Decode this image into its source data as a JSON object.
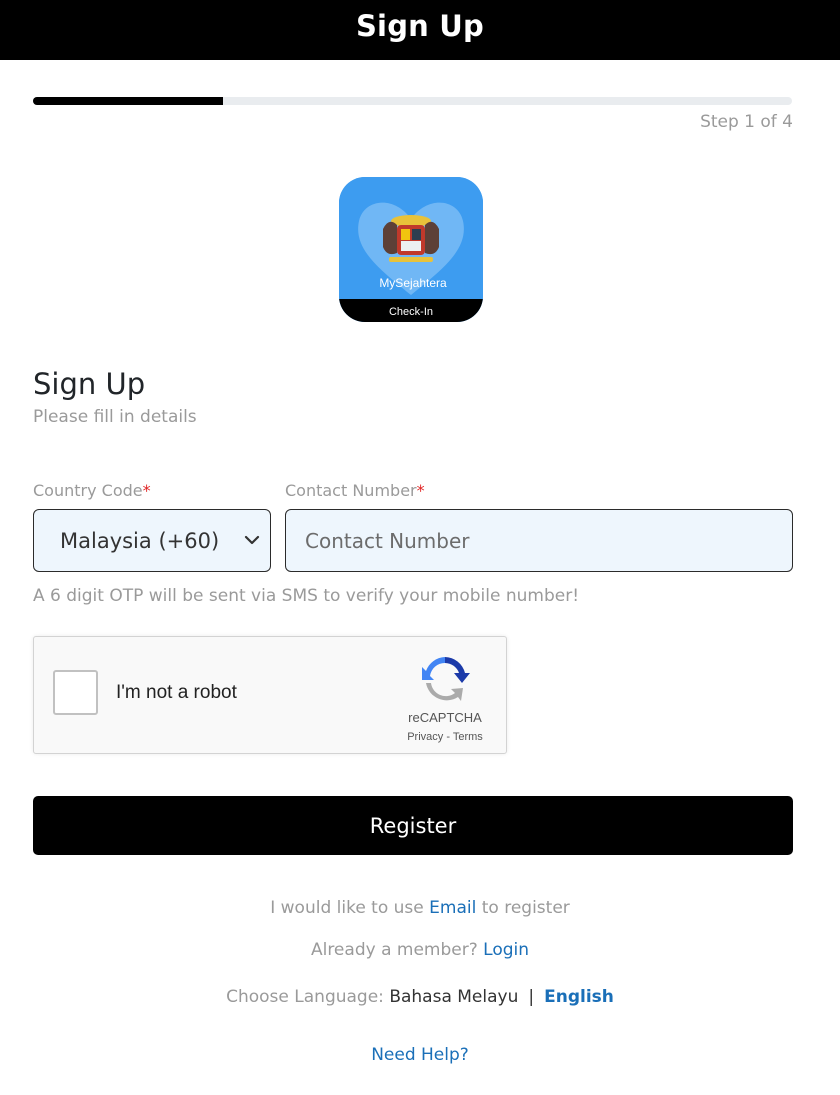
{
  "header": {
    "title": "Sign Up"
  },
  "progress": {
    "fraction": 0.25,
    "step_text": "Step 1 of 4"
  },
  "logo": {
    "name": "MySejahtera",
    "caption": "Check-In"
  },
  "form": {
    "title": "Sign Up",
    "subtitle": "Please fill in details",
    "country_code_label": "Country Code",
    "contact_number_label": "Contact Number",
    "required_mark": "*",
    "country_code_value": "Malaysia (+60)",
    "contact_number_placeholder": "Contact Number",
    "otp_note": "A 6 digit OTP will be sent via SMS to verify your mobile number!"
  },
  "captcha": {
    "label": "I'm not a robot",
    "brand": "reCAPTCHA",
    "links": "Privacy - Terms"
  },
  "register": {
    "label": "Register"
  },
  "footer": {
    "email_prefix": "I would like to use ",
    "email_link": "Email",
    "email_suffix": " to register",
    "member_prefix": "Already a member? ",
    "login_link": "Login",
    "language_prefix": "Choose Language: ",
    "language_malay": "Bahasa Melayu",
    "language_separator": "|",
    "language_english": "English",
    "help_link": "Need Help?"
  },
  "colors": {
    "primary": "#000000",
    "link": "#1a6fb8",
    "logo_blue": "#3d9cf0",
    "input_bg": "#eef6fd",
    "muted_text": "#9a9a9a",
    "required": "#e02424"
  },
  "icons": {
    "select_arrow": "chevron-down-icon",
    "captcha": "recaptcha-icon",
    "logo": "heart-icon"
  }
}
